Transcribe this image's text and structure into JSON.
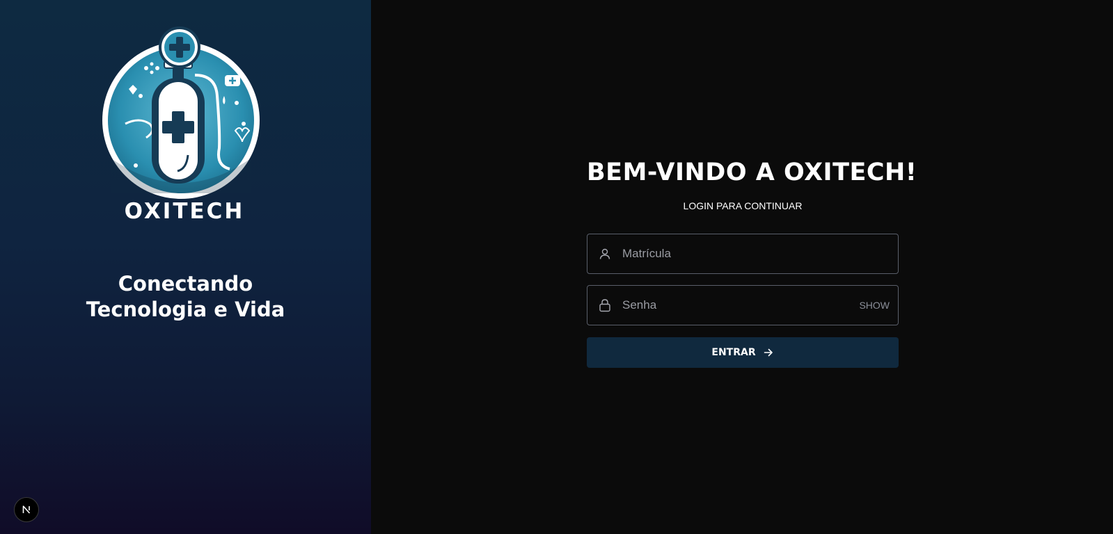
{
  "brand": {
    "logo_text": "OXITECH",
    "tagline_line1": "Conectando",
    "tagline_line2": "Tecnologia e Vida",
    "icon": "oxygen-tank-medical-logo"
  },
  "login": {
    "title": "BEM-VINDO A OXITECH!",
    "subtitle": "LOGIN PARA CONTINUAR",
    "username": {
      "placeholder": "Matrícula",
      "value": "",
      "icon": "user-icon"
    },
    "password": {
      "placeholder": "Senha",
      "value": "",
      "icon": "lock-icon",
      "toggle_label": "SHOW"
    },
    "submit_label": "ENTRAR",
    "submit_icon": "arrow-right-icon"
  },
  "badge": {
    "label": "N",
    "icon": "nextjs-icon"
  },
  "colors": {
    "left_bg_top": "#0e2a41",
    "left_bg_bottom": "#100c28",
    "right_bg": "#0b0b0b",
    "button_bg": "#10293e",
    "logo_teal": "#2a8fb0"
  }
}
